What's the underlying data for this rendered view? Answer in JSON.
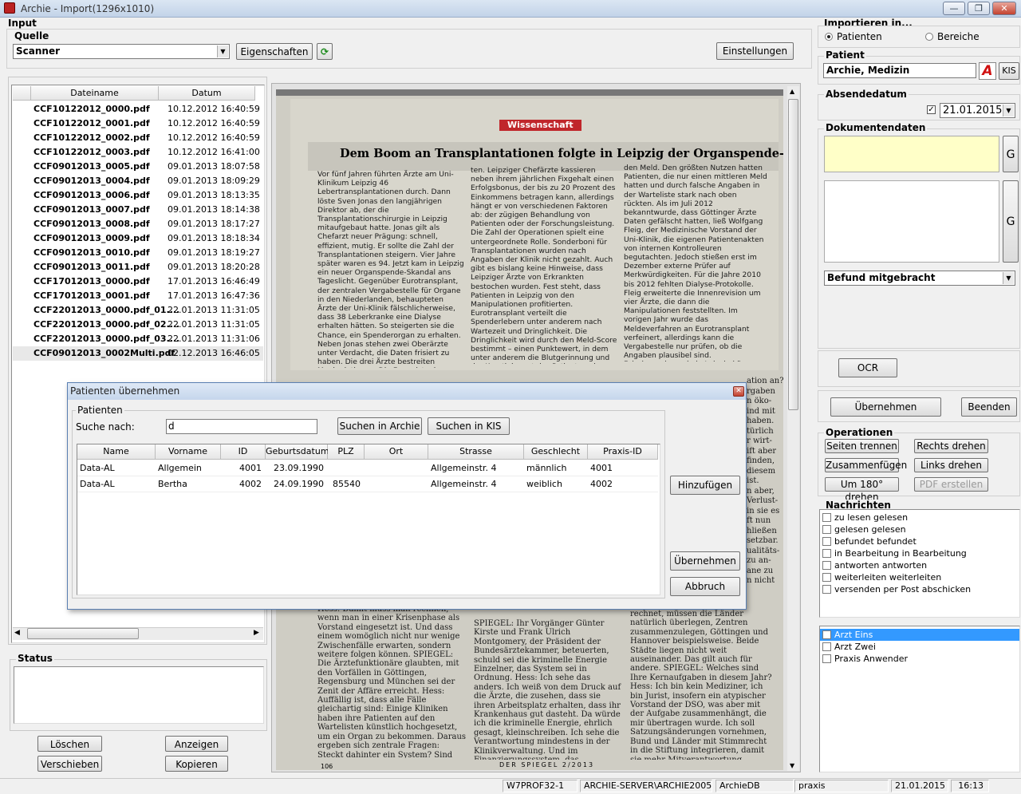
{
  "window": {
    "title": "Archie - Import(1296x1010)",
    "min": "—",
    "max": "❐",
    "close": "✕"
  },
  "input": {
    "label": "Input",
    "quelle_label": "Quelle",
    "source_value": "Scanner",
    "eigenschaften_label": "Eigenschaften",
    "einstellungen_label": "Einstellungen"
  },
  "files": {
    "columns": [
      "Dateiname",
      "Datum"
    ],
    "rows": [
      [
        "CCF10122012_0000.pdf",
        "10.12.2012 16:40:59"
      ],
      [
        "CCF10122012_0001.pdf",
        "10.12.2012 16:40:59"
      ],
      [
        "CCF10122012_0002.pdf",
        "10.12.2012 16:40:59"
      ],
      [
        "CCF10122012_0003.pdf",
        "10.12.2012 16:41:00"
      ],
      [
        "CCF09012013_0005.pdf",
        "09.01.2013 18:07:58"
      ],
      [
        "CCF09012013_0004.pdf",
        "09.01.2013 18:09:29"
      ],
      [
        "CCF09012013_0006.pdf",
        "09.01.2013 18:13:35"
      ],
      [
        "CCF09012013_0007.pdf",
        "09.01.2013 18:14:38"
      ],
      [
        "CCF09012013_0008.pdf",
        "09.01.2013 18:17:27"
      ],
      [
        "CCF09012013_0009.pdf",
        "09.01.2013 18:18:34"
      ],
      [
        "CCF09012013_0010.pdf",
        "09.01.2013 18:19:27"
      ],
      [
        "CCF09012013_0011.pdf",
        "09.01.2013 18:20:28"
      ],
      [
        "CCF17012013_0000.pdf",
        "17.01.2013 16:46:49"
      ],
      [
        "CCF17012013_0001.pdf",
        "17.01.2013 16:47:36"
      ],
      [
        "CCF22012013_0000.pdf_01....",
        "22.01.2013 11:31:05"
      ],
      [
        "CCF22012013_0000.pdf_02....",
        "22.01.2013 11:31:05"
      ],
      [
        "CCF22012013_0000.pdf_03....",
        "22.01.2013 11:31:06"
      ],
      [
        "CCF09012013_0002Multi.pdf",
        "02.12.2013 16:46:05"
      ]
    ]
  },
  "status": {
    "label": "Status"
  },
  "left_buttons": {
    "loeschen": "Löschen",
    "anzeigen": "Anzeigen",
    "verschieben": "Verschieben",
    "kopieren": "Kopieren"
  },
  "document": {
    "section": "Wissenschaft",
    "headline": "Dem Boom an Transplantationen folgte in Leipzig der Organspende-Skandal.",
    "col1": "Vor fünf Jahren führten Ärzte am Uni-Klinikum Leipzig 46 Lebertransplantationen durch. Dann löste Sven Jonas den langjährigen Direktor ab, der die Transplantationschirurgie in Leipzig mitaufgebaut hatte. Jonas gilt als Chefarzt neuer Prägung: schnell, effizient, mutig. Er sollte die Zahl der Transplantationen steigern. Vier Jahre später waren es 94. Jetzt kam in Leipzig ein neuer Organspende-Skandal ans Tageslicht. Gegenüber Eurotransplant, der zentralen Vergabestelle für Organe in den Niederlanden, behaupteten Ärzte der Uni-Klinik fälschlicherweise, dass 38 Leberkranke eine Dialyse erhalten hätten. So steigerten sie die Chance, ein Spenderorgan zu erhalten. Neben Jonas stehen zwei Oberärzte unter Verdacht, die Daten frisiert zu haben. Die drei Ärzte bestreiten Manipulationen. Die Frage ist, ob Honorare die Ärzte zu den Falschangaben motiviert haben könn-",
    "col2": "ten. Leipziger Chefärzte kassieren neben ihrem jährlichen Fixgehalt einen Erfolgsbonus, der bis zu 20 Prozent des Einkommens betragen kann, allerdings hängt er von verschiedenen Faktoren ab: der zügigen Behandlung von Patienten oder der Forschungsleistung. Die Zahl der Operationen spielt eine untergeordnete Rolle. Sonderboni für Transplantationen wurden nach Angaben der Klinik nicht gezahlt. Auch gibt es bislang keine Hinweise, dass Leipziger Ärzte von Erkrankten bestochen wurden. Fest steht, dass Patienten in Leipzig von den Manipulationen profitierten. Eurotransplant verteilt die Spenderlebern unter anderem nach Wartezeit und Dringlichkeit. Die Dringlichkeit wird durch den Meld-Score bestimmt – einen Punktewert, in dem unter anderem die Blutgerinnung und der Kreatininwert des Patienten eine Rolle spielen. Eine Dialyse steigert",
    "col3": "den Meld. Den größten Nutzen hatten Patienten, die nur einen mittleren Meld hatten und durch falsche Angaben in der Warteliste stark nach oben rückten. Als im Juli 2012 bekanntwurde, dass Göttinger Ärzte Daten gefälscht hatten, ließ Wolfgang Fleig, der Medizinische Vorstand der Uni-Klinik, die eigenen Patientenakten von internen Kontrolleuren begutachten. Jedoch stießen erst im Dezember externe Prüfer auf Merkwürdigkeiten. Für die Jahre 2010 bis 2012 fehlten Dialyse-Protokolle. Fleig erweiterte die Innenrevision um vier Ärzte, die dann die Manipulationen feststellten. Im vorigen Jahr wurde das Meldeverfahren an Eurotransplant verfeinert, allerdings kann die Vergabestelle nur prüfen, ob die Angaben plausibel sind. Falschangaben wie in Leipzig können weiterhin ausschließlich bei Kontrollen in den Kliniken entdeckt werden.",
    "lower1": "Hess: Damit muss man rechnen, wenn man in einer Krisenphase als Vorstand eingesetzt ist. Und dass einem womöglich nicht nur wenige Zwischenfälle erwarten, sondern weitere folgen können. SPIEGEL: Die Ärztefunktionäre glaubten, mit den Vorfällen in Göttingen, Regensburg und München sei der Zenit der Affäre erreicht. Hess: Auffällig ist, dass alle Fälle gleichartig sind: Einige Kliniken haben ihre Patienten auf den Wartelisten künstlich hochgesetzt, um ein Organ zu bekommen. Daraus ergeben sich zentrale Fragen: Steckt dahinter ein System? Sind Kliniken auf mehr Transplantationen angewiesen, um ihre Ökonomie zu stützen?",
    "lower2": "SPIEGEL: Ihr Vorgänger Günter Kirste und Frank Ulrich Montgomery, der Präsident der Bundesärztekammer, beteuerten, schuld sei die kriminelle Energie Einzelner, das System sei in Ordnung. Hess: Ich sehe das anders. Ich weiß von dem Druck auf die Ärzte, die zusehen, dass sie ihren Arbeitsplatz erhalten, dass ihr Krankenhaus gut dasteht. Da würde ich die kriminelle Energie, ehrlich gesagt, kleinschreiben. Ich sehe die Verantwortung mindestens in der Klinikverwaltung. Und im Finanzierungssystem, das unmedizinisches Verhalten fördert und Fehlanreize setzt.",
    "lower3": "rechnet, müssen die Länder natürlich überlegen, Zentren zusammenzulegen, Göttingen und Hannover beispielsweise. Beide Städte liegen nicht weit auseinander. Das gilt auch für andere. SPIEGEL: Welches sind Ihre Kernaufgaben in diesem Jahr? Hess: Ich bin kein Mediziner, ich bin Jurist, insofern ein atypischer Vorstand der DSO, was aber mit der Aufgabe zusammenhängt, die mir übertragen wurde. Ich soll Satzungsänderungen vornehmen, Bund und Länder mit Stimmrecht in die Stiftung integrieren, damit sie mehr Mitverantwortung übernehmen können. Über allem steht die Frage: Wie muss die",
    "side_snips": [
      "ation an?",
      "rgaben",
      "n öko-",
      "ind mit",
      "haben.",
      "türlich",
      "r wirt-",
      "ift aber",
      "finden,",
      "diesem",
      "ist.",
      "n aber,",
      "Verlust-",
      "in sie es",
      "ft nun",
      "hließen",
      "setzbar.",
      "ualitäts-",
      "zu an-",
      "ane zu",
      "n nicht"
    ],
    "footer": "DER SPIEGEL 2/2013",
    "page_no": "106"
  },
  "right": {
    "importieren_label": "Importieren in...",
    "radio_patienten": "Patienten",
    "radio_bereiche": "Bereiche",
    "patient_label": "Patient",
    "patient_value": "Archie, Medizin",
    "kis_label": "KIS",
    "absendedatum_label": "Absendedatum",
    "date_value": "21.01.2015",
    "dokumentendaten_label": "Dokumentendaten",
    "g_label": "G",
    "befund_value": "Befund mitgebracht",
    "ocr_label": "OCR",
    "uebernehmen_label": "Übernehmen",
    "beenden_label": "Beenden",
    "operationen_label": "Operationen",
    "ops": {
      "seiten_trennen": "Seiten trennen",
      "rechts_drehen": "Rechts drehen",
      "zusammenfuegen": "Zusammenfügen",
      "links_drehen": "Links drehen",
      "um180": "Um 180° drehen",
      "pdf_erstellen": "PDF erstellen"
    },
    "nachrichten_label": "Nachrichten",
    "messages": [
      "zu lesen gelesen",
      "gelesen gelesen",
      "befundet befundet",
      "in Bearbeitung in Bearbeitung",
      "antworten antworten",
      "weiterleiten weiterleiten",
      "versenden per Post abschicken"
    ],
    "recipients": [
      "Arzt Eins",
      "Arzt Zwei",
      "Praxis Anwender"
    ],
    "selected_recipient": "Arzt Eins"
  },
  "dialog": {
    "title": "Patienten übernehmen",
    "close": "✕",
    "group_label": "Patienten",
    "search_label": "Suche nach:",
    "search_value": "d",
    "search_archie": "Suchen in Archie",
    "search_kis": "Suchen in KIS",
    "columns": [
      "Name",
      "Vorname",
      "ID",
      "Geburtsdatum",
      "PLZ",
      "Ort",
      "Strasse",
      "Geschlecht",
      "Praxis-ID"
    ],
    "rows": [
      [
        "Data-AL",
        "Allgemein",
        "4001",
        "23.09.1990",
        "",
        "",
        "Allgemeinstr. 4",
        "männlich",
        "4001"
      ],
      [
        "Data-AL",
        "Bertha",
        "4002",
        "24.09.1990",
        "85540",
        "",
        "Allgemeinstr. 4",
        "weiblich",
        "4002"
      ]
    ],
    "hinzufuegen": "Hinzufügen",
    "uebernehmen": "Übernehmen",
    "abbruch": "Abbruch"
  },
  "statusbar": [
    "W7PROF32-1",
    "ARCHIE-SERVER\\ARCHIE2005",
    "ArchieDB",
    "praxis",
    "21.01.2015",
    "16:13"
  ],
  "colors": {
    "accent": "#3399ff",
    "yellow_field": "#ffffc8",
    "section_red": "#c0262b"
  }
}
